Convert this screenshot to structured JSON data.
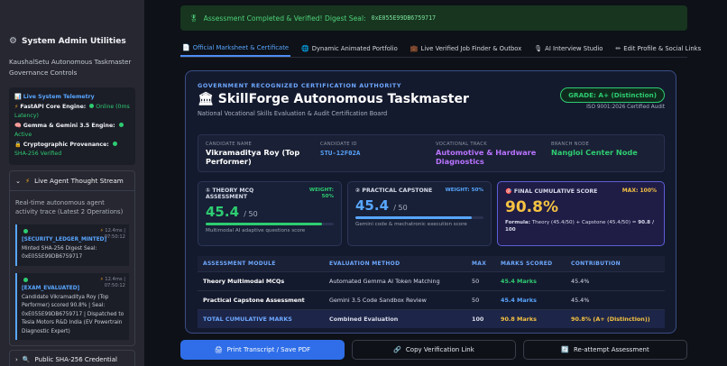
{
  "sidebar": {
    "title": "System Admin Utilities",
    "subtitle": "KaushalSetu Autonomous Taskmaster Governance Controls",
    "telemetry": {
      "heading": "Live System Telemetry",
      "fastapi_label": "FastAPI Core Engine:",
      "fastapi_value": "Online (0ms Latency)",
      "gemma_label": "Gemma & Gemini 3.5 Engine:",
      "gemma_value": "Active",
      "crypto_label": "Cryptographic Provenance:",
      "crypto_value": "SHA-256 Verified"
    },
    "stream": {
      "heading": "Live Agent Thought Stream",
      "description": "Real-time autonomous agent activity trace (Latest 2 Operations)",
      "ops": [
        {
          "tag": "[SECURITY_LEDGER_MINTED]",
          "ms": "12.4ms |",
          "time": "07:50:12",
          "text": "Minted SHA-256 Digest Seal: 0xE055E99DB6759717"
        },
        {
          "tag": "[EXAM_EVALUATED]",
          "ms": "12.4ms |",
          "time": "07:50:12",
          "text": "Candidate Vikramaditya Roy (Top Performer) scored 90.8% | Seal: 0xE055E99DB6759717 | Dispatched to Tesla Motors R&D India (EV Powertrain Diagnostic Expert)"
        }
      ]
    },
    "public_label": "Public SHA-256 Credential"
  },
  "banner": {
    "text": "Assessment Completed & Verified! Digest Seal:",
    "seal": "0xE055E99DB6759717"
  },
  "tabs": [
    {
      "label": "Official Marksheet & Certificate",
      "icon": "📄"
    },
    {
      "label": "Dynamic Animated Portfolio",
      "icon": "🌐"
    },
    {
      "label": "Live Verified Job Finder & Outbox",
      "icon": "💼"
    },
    {
      "label": "AI Interview Studio",
      "icon": "🎙"
    },
    {
      "label": "Edit Profile & Social Links",
      "icon": "✏"
    }
  ],
  "certificate": {
    "authority": "GOVERNMENT RECOGNIZED CERTIFICATION AUTHORITY",
    "brand": "SkillForge Autonomous Taskmaster",
    "board": "National Vocational Skills Evaluation & Audit Certification Board",
    "grade": "GRADE: A+ (Distinction)",
    "iso": "ISO 9001:2026 Certified Audit",
    "candidate": {
      "name_label": "CANDIDATE NAME",
      "name": "Vikramaditya Roy (Top Performer)",
      "id_label": "CANDIDATE ID",
      "id": "STU-12F02A",
      "track_label": "VOCATIONAL TRACK",
      "track": "Automotive & Hardware Diagnostics",
      "branch_label": "BRANCH NODE",
      "branch": "Nangloi Center Node"
    },
    "theory": {
      "title": "THEORY MCQ ASSESSMENT",
      "weight": "WEIGHT: 50%",
      "score": "45.4",
      "out_of": "/ 50",
      "progress": 0.908,
      "caption": "Multimodal AI adaptive questions score"
    },
    "practical": {
      "title": "PRACTICAL CAPSTONE",
      "weight": "WEIGHT: 50%",
      "score": "45.4",
      "out_of": "/ 50",
      "progress": 0.908,
      "caption": "Gemini code & mechatronic execution score"
    },
    "final": {
      "title": "FINAL CUMULATIVE SCORE",
      "max": "MAX: 100%",
      "score": "90.8%",
      "formula_label": "Formula:",
      "formula": "Theory (45.4/50) + Capstone (45.4/50) =",
      "formula_result": "90.8 / 100"
    },
    "table": {
      "headers": [
        "ASSESSMENT MODULE",
        "EVALUATION METHOD",
        "MAX",
        "MARKS SCORED",
        "CONTRIBUTION"
      ],
      "rows": [
        [
          "Theory Multimodal MCQs",
          "Automated Gemma AI Token Matching",
          "50",
          "45.4 Marks",
          "45.4%"
        ],
        [
          "Practical Capstone Assessment",
          "Gemini 3.5 Code Sandbox Review",
          "50",
          "45.4 Marks",
          "45.4%"
        ],
        [
          "TOTAL CUMULATIVE MARKS",
          "Combined Evaluation",
          "100",
          "90.8 Marks",
          "90.8% (A+ (Distinction))"
        ]
      ]
    }
  },
  "actions": {
    "print": "Print Transcript / Save PDF",
    "copy": "Copy Verification Link",
    "reattempt": "Re-attempt Assessment"
  },
  "colors": {
    "accent": "#2f6ee8",
    "success": "#2ecc71",
    "gold": "#f5c242",
    "purple": "#b873ff"
  }
}
